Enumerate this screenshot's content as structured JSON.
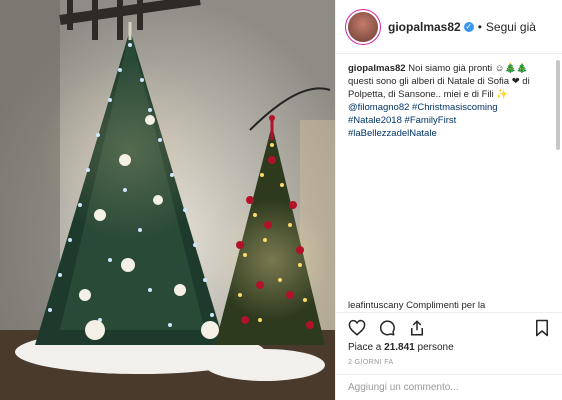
{
  "account": {
    "username": "giopalmas82",
    "follow_label": "Segui già",
    "separator": "•"
  },
  "caption": {
    "username": "giopalmas82",
    "text": "Noi siamo già pronti ☺🎄🎄 questi sono gli alberi di Natale di Sofia ❤ di Polpetta, di Sansone.. miei e di Fili ✨",
    "mention": "@filomagno82",
    "hashtags": [
      "#Christmasiscoming",
      "#Natale2018",
      "#FamilyFirst",
      "#laBellezzadelNatale"
    ]
  },
  "comment_preview": "leafintuscany Complimenti per la",
  "likes": {
    "prefix": "Piace a ",
    "count": "21.841",
    "suffix": " persone"
  },
  "timestamp": "2 GIORNI FA",
  "comment_input": {
    "placeholder": "Aggiungi un commento..."
  },
  "icons": [
    "heart-icon",
    "comment-icon",
    "share-icon",
    "bookmark-icon",
    "verified-icon"
  ],
  "colors": {
    "link": "#003569",
    "verified": "#3897f0",
    "text": "#262626",
    "muted": "#999999"
  }
}
